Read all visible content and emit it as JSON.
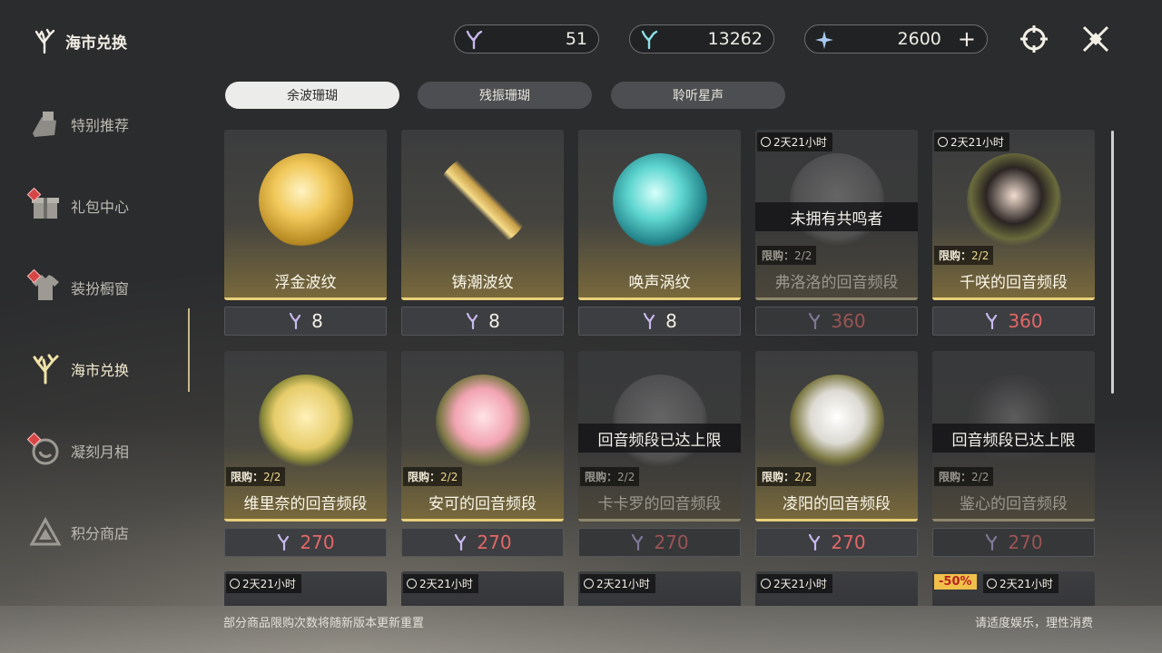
{
  "header": {
    "title": "海市兑换"
  },
  "sidebar": {
    "items": [
      {
        "label": "特别推荐",
        "icon": "gift-box-icon",
        "badge": false
      },
      {
        "label": "礼包中心",
        "icon": "present-icon",
        "badge": true
      },
      {
        "label": "装扮橱窗",
        "icon": "outfit-icon",
        "badge": true
      },
      {
        "label": "海市兑换",
        "icon": "coral-icon",
        "badge": false,
        "active": true
      },
      {
        "label": "凝刻月相",
        "icon": "moon-icon",
        "badge": true
      },
      {
        "label": "积分商店",
        "icon": "triangle-icon",
        "badge": false
      }
    ]
  },
  "currencies": [
    {
      "icon": "coral-currency-icon",
      "value": "51"
    },
    {
      "icon": "tide-currency-icon",
      "value": "13262"
    },
    {
      "icon": "star-crystal-icon",
      "value": "2600",
      "plus": "+"
    }
  ],
  "tabs": [
    {
      "label": "余波珊瑚",
      "active": true
    },
    {
      "label": "残振珊瑚",
      "active": false
    },
    {
      "label": "聆听星声",
      "active": false
    }
  ],
  "items": [
    {
      "name": "浮金波纹",
      "price": "8",
      "price_style": "white",
      "art": "gold-orb"
    },
    {
      "name": "铸潮波纹",
      "price": "8",
      "price_style": "white",
      "art": "gold-blade"
    },
    {
      "name": "唤声涡纹",
      "price": "8",
      "price_style": "white",
      "art": "teal-orb"
    },
    {
      "name": "弗洛洛的回音频段",
      "price": "360",
      "price_style": "redDim",
      "timer": "2天21小时",
      "limit_label": "限购：",
      "limit": "2/2",
      "overlay": "未拥有共鸣者",
      "dim": true,
      "art": "grey-portrait"
    },
    {
      "name": "千咲的回音频段",
      "price": "360",
      "price_style": "red",
      "timer": "2天21小时",
      "limit_label": "限购：",
      "limit": "2/2",
      "art": "dark-hair-portrait"
    },
    {
      "name": "维里奈的回音频段",
      "price": "270",
      "price_style": "red",
      "limit_label": "限购：",
      "limit": "2/2",
      "art": "blonde-portrait"
    },
    {
      "name": "安可的回音频段",
      "price": "270",
      "price_style": "red",
      "limit_label": "限购：",
      "limit": "2/2",
      "art": "pink-portrait"
    },
    {
      "name": "卡卡罗的回音频段",
      "price": "270",
      "price_style": "redDim",
      "limit_label": "限购：",
      "limit": "2/2",
      "overlay": "回音频段已达上限",
      "dim": true,
      "art": "grey-portrait"
    },
    {
      "name": "凌阳的回音频段",
      "price": "270",
      "price_style": "red",
      "limit_label": "限购：",
      "limit": "2/2",
      "art": "white-hair-portrait"
    },
    {
      "name": "鉴心的回音频段",
      "price": "270",
      "price_style": "redDim",
      "limit_label": "限购：",
      "limit": "2/2",
      "overlay": "回音频段已达上限",
      "dim": true,
      "art": "grey-portrait"
    }
  ],
  "partial_row": [
    {
      "timer": "2天21小时"
    },
    {
      "timer": "2天21小时"
    },
    {
      "timer": "2天21小时"
    },
    {
      "timer": "2天21小时"
    },
    {
      "timer": "2天21小时",
      "discount": "-50%"
    }
  ],
  "footer": {
    "left": "部分商品限购次数将随新版本更新重置",
    "right": "请适度娱乐，理性消费"
  },
  "colors": {
    "accent_gold": "#e8cf7a",
    "price_red": "#e36767",
    "tab_active": "#ececea"
  }
}
